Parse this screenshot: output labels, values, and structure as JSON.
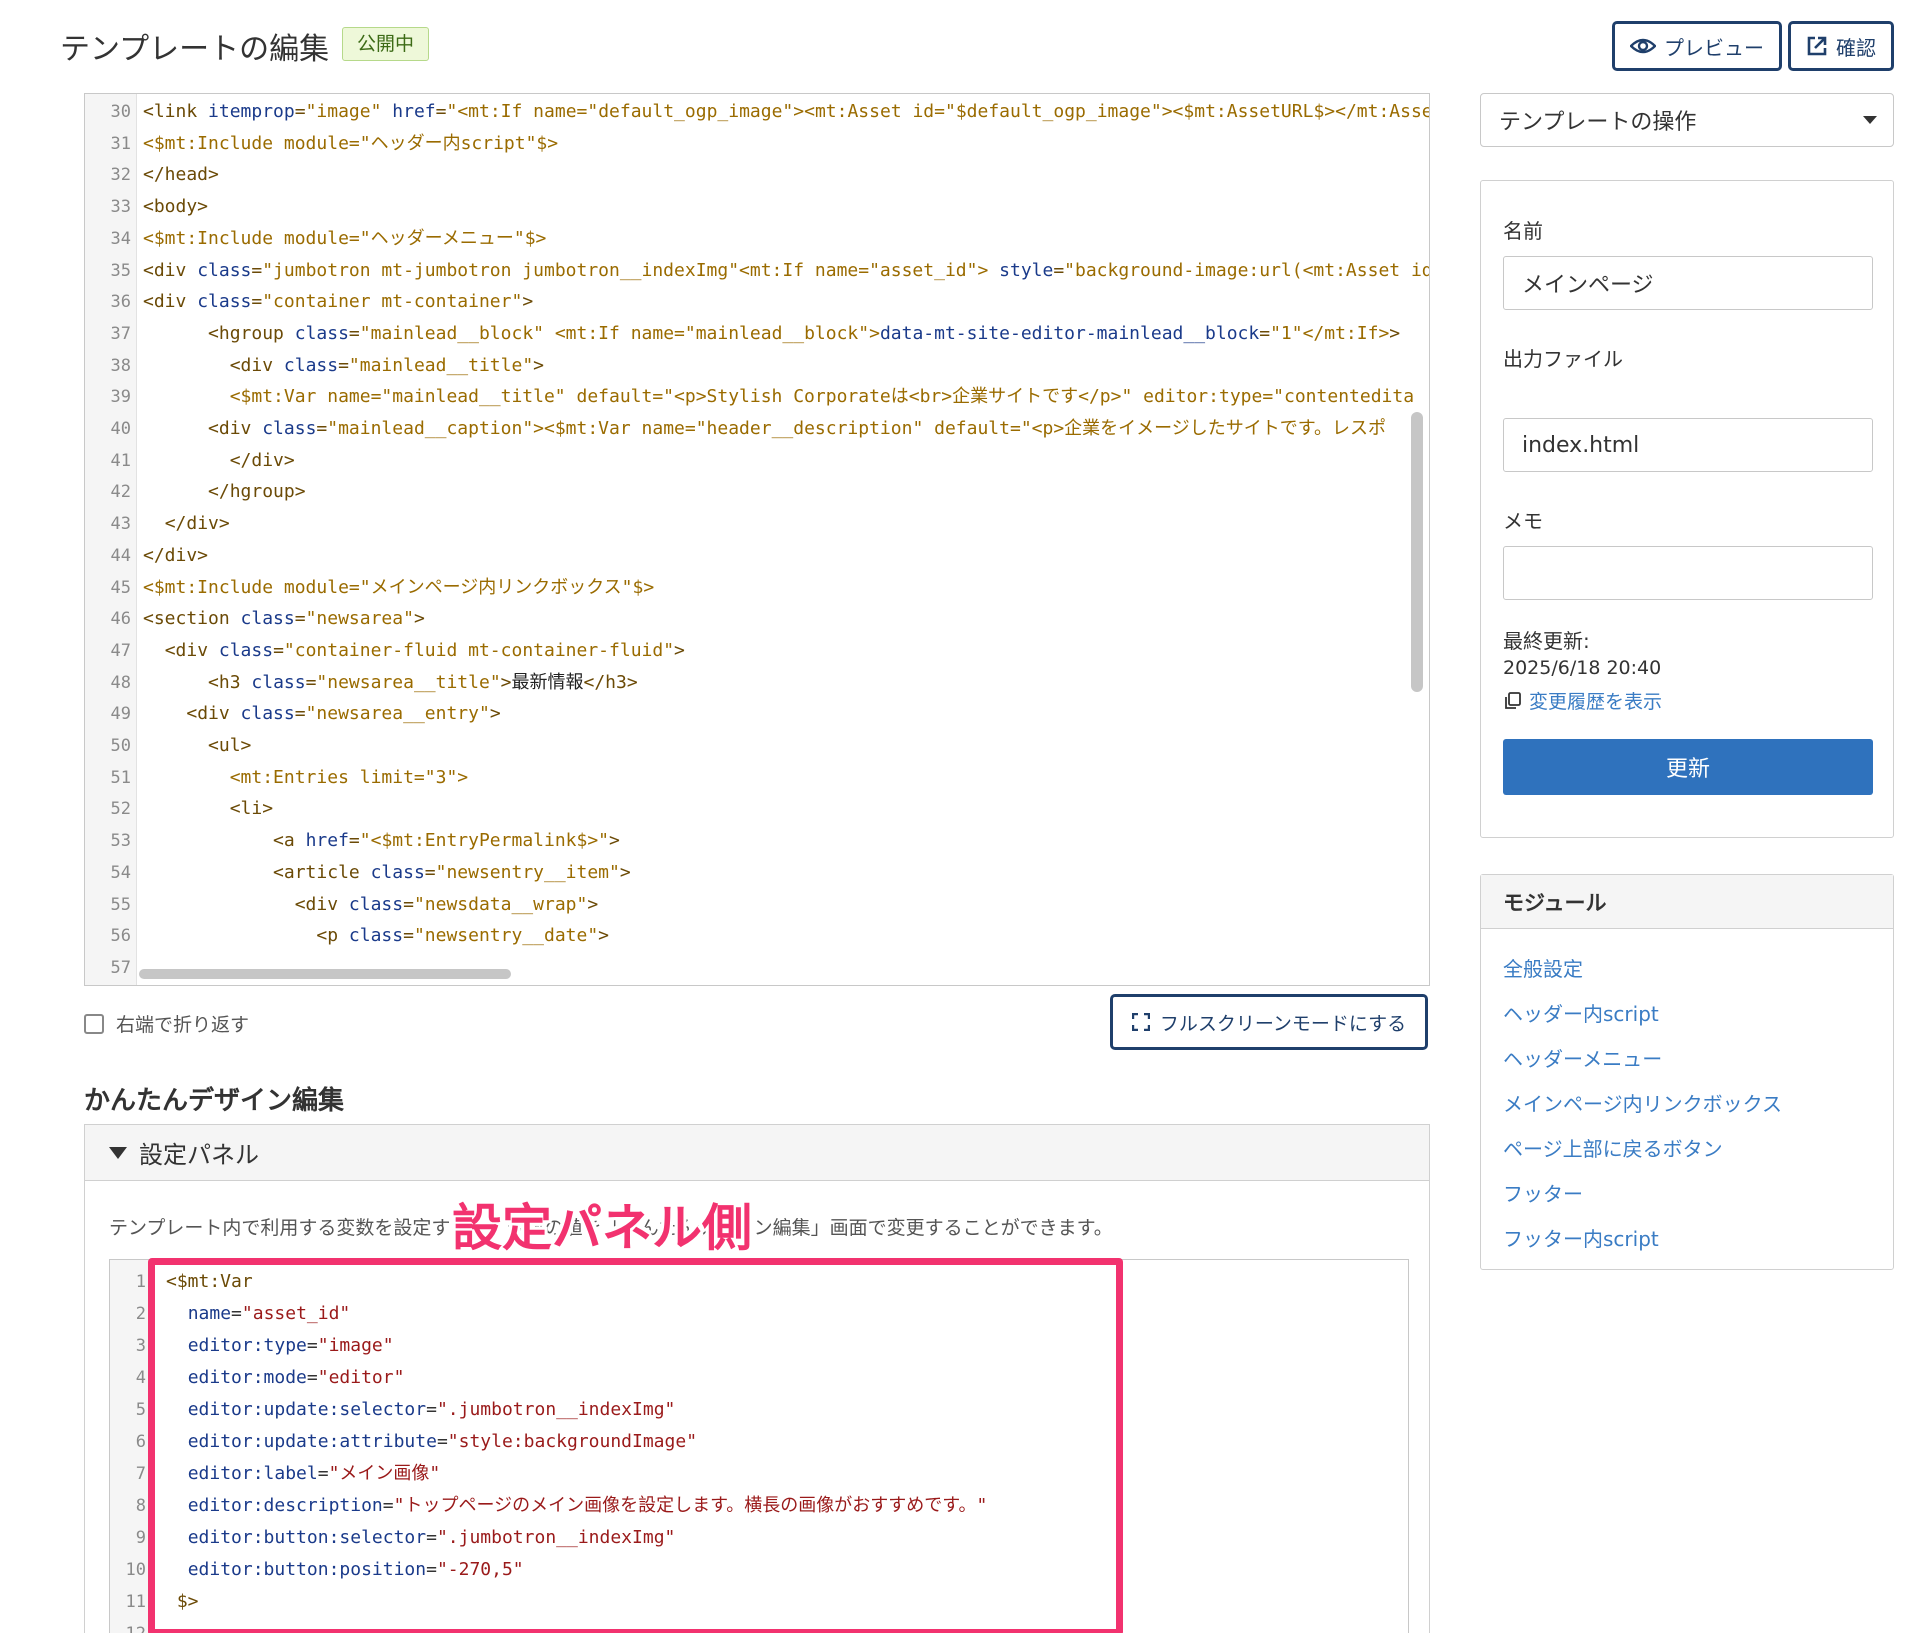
{
  "header": {
    "title": "テンプレートの編集",
    "status_badge": "公開中",
    "preview_label": "プレビュー",
    "confirm_label": "確認"
  },
  "editor": {
    "lines": [
      {
        "n": "30",
        "html": "<span class=\"tag\">&lt;link </span><span class=\"attr\">itemprop</span>=<span class=\"val\">\"image\"</span> <span class=\"attr\">href</span>=<span class=\"val\">\"&lt;mt:If name=\"default_ogp_image\"&gt;&lt;mt:Asset id=\"$default_ogp_image\"&gt;&lt;$mt:AssetURL$&gt;&lt;/mt:Asset</span>"
      },
      {
        "n": "31",
        "html": "<span class=\"val\">&lt;$mt:Include module=\"ヘッダー内script\"$&gt;</span>"
      },
      {
        "n": "32",
        "html": "<span class=\"tag\">&lt;/head&gt;</span>"
      },
      {
        "n": "33",
        "html": "<span class=\"tag\">&lt;body&gt;</span>"
      },
      {
        "n": "34",
        "html": "<span class=\"val\">&lt;$mt:Include module=\"ヘッダーメニュー\"$&gt;</span>"
      },
      {
        "n": "35",
        "html": "<span class=\"tag\">&lt;div </span><span class=\"attr\">class</span>=<span class=\"val\">\"jumbotron mt-jumbotron jumbotron__indexImg\"&lt;mt:If name=\"asset_id\"&gt;</span> <span class=\"attr\">style</span>=<span class=\"val\">\"background-image:url(&lt;mt:Asset id=</span>"
      },
      {
        "n": "36",
        "html": "<span class=\"tag\">&lt;div </span><span class=\"attr\">class</span>=<span class=\"val\">\"container mt-container\"</span><span class=\"tag\">&gt;</span>"
      },
      {
        "n": "37",
        "html": "      <span class=\"tag\">&lt;hgroup </span><span class=\"attr\">class</span>=<span class=\"val\">\"mainlead__block\" &lt;mt:If name=\"mainlead__block\"&gt;</span><span class=\"attr\">data-mt-site-editor-mainlead__block</span>=<span class=\"val\">\"1\"&lt;/mt:If&gt;</span><span class=\"tag\">&gt;</span>"
      },
      {
        "n": "38",
        "html": "        <span class=\"tag\">&lt;div </span><span class=\"attr\">class</span>=<span class=\"val\">\"mainlead__title\"</span><span class=\"tag\">&gt;</span>"
      },
      {
        "n": "39",
        "html": "        <span class=\"val\">&lt;$mt:Var name=\"mainlead__title\" default=\"&lt;p&gt;Stylish Corporateは&lt;br&gt;企業サイトです&lt;/p&gt;\" editor:type=\"contentedita</span>"
      },
      {
        "n": "40",
        "html": "      <span class=\"tag\">&lt;div </span><span class=\"attr\">class</span>=<span class=\"val\">\"mainlead__caption\"&gt;&lt;$mt:Var name=\"header__description\" default=\"&lt;p&gt;企業をイメージしたサイトです。レスポ</span>"
      },
      {
        "n": "41",
        "html": "        <span class=\"tag\">&lt;/div&gt;</span>"
      },
      {
        "n": "42",
        "html": "      <span class=\"tag\">&lt;/hgroup&gt;</span>"
      },
      {
        "n": "43",
        "html": "  <span class=\"tag\">&lt;/div&gt;</span>"
      },
      {
        "n": "44",
        "html": "<span class=\"tag\">&lt;/div&gt;</span>"
      },
      {
        "n": "45",
        "html": "<span class=\"val\">&lt;$mt:Include module=\"メインページ内リンクボックス\"$&gt;</span>"
      },
      {
        "n": "46",
        "html": "<span class=\"tag\">&lt;section </span><span class=\"attr\">class</span>=<span class=\"val\">\"newsarea\"</span><span class=\"tag\">&gt;</span>"
      },
      {
        "n": "47",
        "html": "  <span class=\"tag\">&lt;div </span><span class=\"attr\">class</span>=<span class=\"val\">\"container-fluid mt-container-fluid\"</span><span class=\"tag\">&gt;</span>"
      },
      {
        "n": "48",
        "html": "      <span class=\"tag\">&lt;h3 </span><span class=\"attr\">class</span>=<span class=\"val\">\"newsarea__title\"</span><span class=\"tag\">&gt;</span><span style=\"color:#222\">最新情報</span><span class=\"tag\">&lt;/h3&gt;</span>"
      },
      {
        "n": "49",
        "html": "    <span class=\"tag\">&lt;div </span><span class=\"attr\">class</span>=<span class=\"val\">\"newsarea__entry\"</span><span class=\"tag\">&gt;</span>"
      },
      {
        "n": "50",
        "html": "      <span class=\"tag\">&lt;ul&gt;</span>"
      },
      {
        "n": "51",
        "html": "        <span class=\"val\">&lt;mt:Entries limit=\"3\"&gt;</span>"
      },
      {
        "n": "52",
        "html": "        <span class=\"tag\">&lt;li&gt;</span>"
      },
      {
        "n": "53",
        "html": "            <span class=\"tag\">&lt;a </span><span class=\"attr\">href</span>=<span class=\"val\">\"&lt;$mt:EntryPermalink$&gt;\"</span><span class=\"tag\">&gt;</span>"
      },
      {
        "n": "54",
        "html": "            <span class=\"tag\">&lt;article </span><span class=\"attr\">class</span>=<span class=\"val\">\"newsentry__item\"</span><span class=\"tag\">&gt;</span>"
      },
      {
        "n": "55",
        "html": "              <span class=\"tag\">&lt;div </span><span class=\"attr\">class</span>=<span class=\"val\">\"newsdata__wrap\"</span><span class=\"tag\">&gt;</span>"
      },
      {
        "n": "56",
        "html": "                <span class=\"tag\">&lt;p </span><span class=\"attr\">class</span>=<span class=\"val\">\"newsentry__date\"</span><span class=\"tag\">&gt;</span>"
      },
      {
        "n": "57",
        "html": ""
      }
    ]
  },
  "below_editor": {
    "wrap_label": "右端で折り返す",
    "fullscreen_label": "フルスクリーンモードにする",
    "section_title": "かんたんデザイン編集"
  },
  "settings_panel": {
    "title": "設定パネル",
    "description": "テンプレート内で利用する変数を設定すると、変数の値を「かんたんデザイン編集」画面で変更することができます。",
    "annotation": "設定パネル側",
    "lines": [
      {
        "n": "1",
        "html": "<span class=\"in-tag\">&lt;$mt:Var</span>"
      },
      {
        "n": "2",
        "html": "  <span class=\"in-attr\">name</span>=<span class=\"in-val\">\"asset_id\"</span>"
      },
      {
        "n": "3",
        "html": "  <span class=\"in-attr\">editor:type</span>=<span class=\"in-val\">\"image\"</span>"
      },
      {
        "n": "4",
        "html": "  <span class=\"in-attr\">editor:mode</span>=<span class=\"in-val\">\"editor\"</span>"
      },
      {
        "n": "5",
        "html": "  <span class=\"in-attr\">editor:update:selector</span>=<span class=\"in-val\">\".jumbotron__indexImg\"</span>"
      },
      {
        "n": "6",
        "html": "  <span class=\"in-attr\">editor:update:attribute</span>=<span class=\"in-val\">\"style:backgroundImage\"</span>"
      },
      {
        "n": "7",
        "html": "  <span class=\"in-attr\">editor:label</span>=<span class=\"in-val\">\"メイン画像\"</span>"
      },
      {
        "n": "8",
        "html": "  <span class=\"in-attr\">editor:description</span>=<span class=\"in-val\">\"トップページのメイン画像を設定します。横長の画像がおすすめです。\"</span>"
      },
      {
        "n": "9",
        "html": "  <span class=\"in-attr\">editor:button:selector</span>=<span class=\"in-val\">\".jumbotron__indexImg\"</span>"
      },
      {
        "n": "10",
        "html": "  <span class=\"in-attr\">editor:button:position</span>=<span class=\"in-val\">\"-270,5\"</span>"
      },
      {
        "n": "11",
        "html": " <span class=\"in-tag\">$&gt;</span>"
      },
      {
        "n": "12",
        "html": ""
      }
    ]
  },
  "sidebar": {
    "ops_label": "テンプレートの操作",
    "name_label": "名前",
    "name_value": "メインページ",
    "output_label": "出力ファイル",
    "output_value": "index.html",
    "memo_label": "メモ",
    "memo_value": "",
    "updated_label": "最終更新:",
    "updated_value": "2025/6/18 20:40",
    "history_link": "変更履歴を表示",
    "update_button": "更新",
    "modules_title": "モジュール",
    "modules": [
      "全般設定",
      "ヘッダー内script",
      "ヘッダーメニュー",
      "メインページ内リンクボックス",
      "ページ上部に戻るボタン",
      "フッター",
      "フッター内script"
    ]
  },
  "colors": {
    "accent_blue": "#2f72bd",
    "annotation_pink": "#f2326f",
    "navy_border": "#1f3f6b",
    "badge_green_bg": "#eef8d9"
  }
}
